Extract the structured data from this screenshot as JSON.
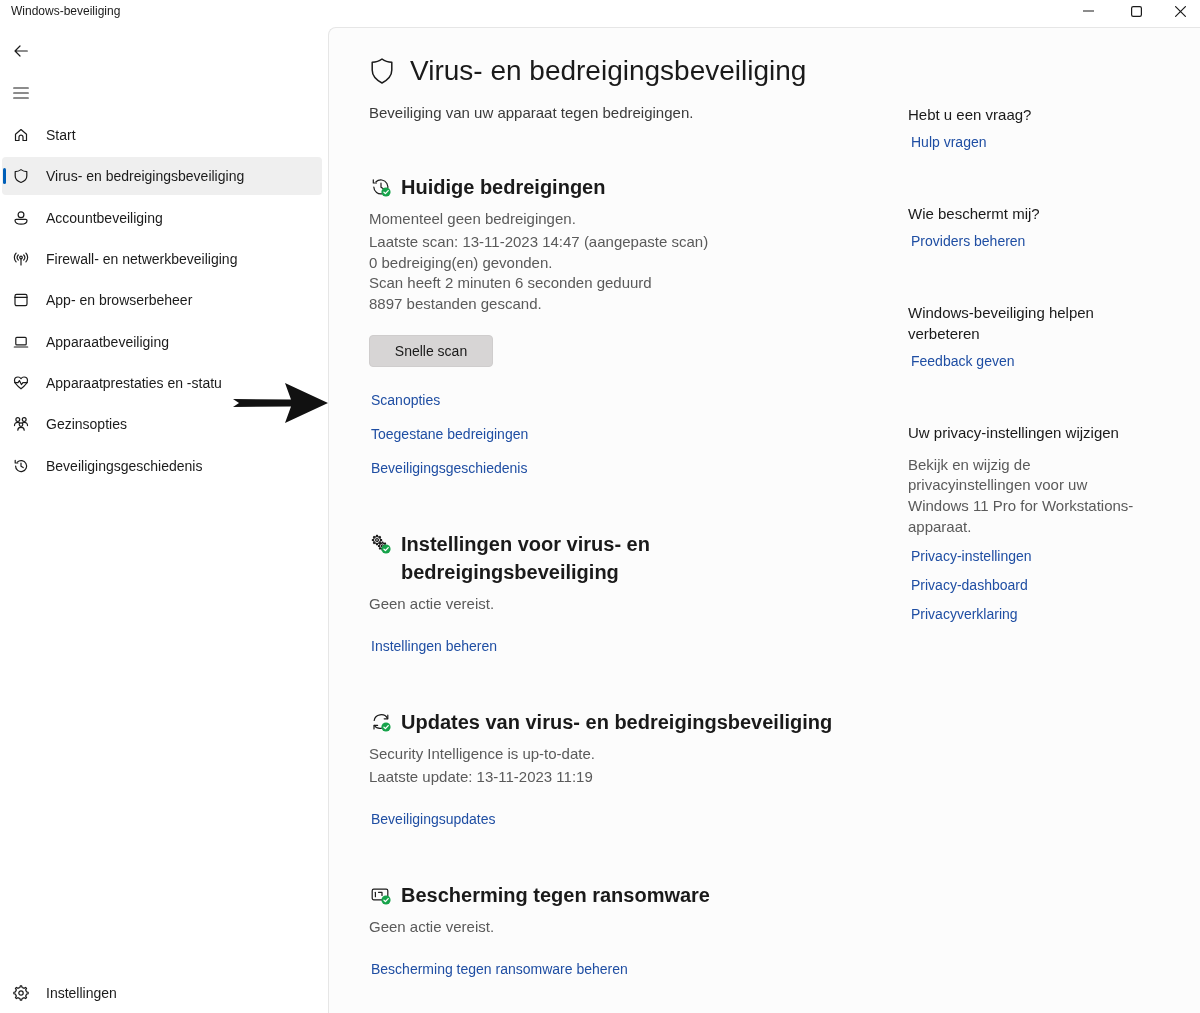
{
  "window": {
    "title": "Windows-beveiliging"
  },
  "sidebar": {
    "items": [
      {
        "kind": "home",
        "label": "Start",
        "selected": false
      },
      {
        "kind": "shield",
        "label": "Virus- en bedreigingsbeveiliging",
        "selected": true
      },
      {
        "kind": "account",
        "label": "Accountbeveiliging",
        "selected": false
      },
      {
        "kind": "network",
        "label": "Firewall- en netwerkbeveiliging",
        "selected": false
      },
      {
        "kind": "app",
        "label": "App- en browserbeheer",
        "selected": false
      },
      {
        "kind": "device",
        "label": "Apparaatbeveiliging",
        "selected": false
      },
      {
        "kind": "health",
        "label": "Apparaatprestaties en -statu",
        "selected": false
      },
      {
        "kind": "family",
        "label": "Gezinsopties",
        "selected": false
      },
      {
        "kind": "history",
        "label": "Beveiligingsgeschiedenis",
        "selected": false
      }
    ],
    "settings": {
      "label": "Instellingen"
    }
  },
  "page": {
    "title": "Virus- en bedreigingsbeveiliging",
    "subtitle": "Beveiliging van uw apparaat tegen bedreigingen."
  },
  "sections": [
    {
      "kind": "threats",
      "ok": true,
      "heading": "Huidige bedreigingen",
      "status": "Momenteel geen bedreigingen.",
      "details": [
        "Laatste scan: 13-11-2023 14:47 (aangepaste scan)",
        "0 bedreiging(en) gevonden.",
        "Scan heeft 2 minuten 6 seconden geduurd",
        "8897 bestanden gescand."
      ],
      "button": "Snelle scan",
      "links": [
        "Scanopties",
        "Toegestane bedreigingen",
        "Beveiligingsgeschiedenis"
      ]
    },
    {
      "kind": "settings",
      "ok": true,
      "heading": "Instellingen voor virus- en bedreigingsbeveiliging",
      "status": "Geen actie vereist.",
      "links": [
        "Instellingen beheren"
      ]
    },
    {
      "kind": "updates",
      "ok": true,
      "heading": "Updates van virus- en bedreigingsbeveiliging",
      "status": "Security Intelligence is up-to-date.",
      "details": [
        "Laatste update: 13-11-2023 11:19"
      ],
      "links": [
        "Beveiligingsupdates"
      ]
    },
    {
      "kind": "ransomware",
      "ok": true,
      "heading": "Bescherming tegen ransomware",
      "status": "Geen actie vereist.",
      "links": [
        "Bescherming tegen ransomware beheren"
      ]
    }
  ],
  "side_panel": {
    "groups": [
      {
        "heading": "Hebt u een vraag?",
        "links": [
          "Hulp vragen"
        ]
      },
      {
        "heading": "Wie beschermt mij?",
        "links": [
          "Providers beheren"
        ]
      },
      {
        "heading": "Windows-beveiliging helpen verbeteren",
        "links": [
          "Feedback geven"
        ]
      },
      {
        "heading": "Uw privacy-instellingen wijzigen",
        "text": "Bekijk en wijzig de privacyinstellingen voor uw Windows 11 Pro for Workstations-apparaat.",
        "links": [
          "Privacy-instellingen",
          "Privacy-dashboard",
          "Privacyverklaring"
        ]
      }
    ]
  }
}
